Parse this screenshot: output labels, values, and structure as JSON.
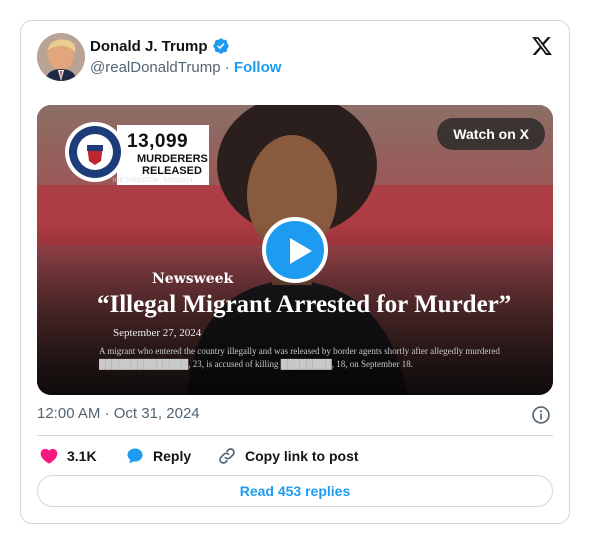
{
  "author": {
    "name": "Donald J. Trump",
    "handle": "@realDonaldTrump",
    "separator": "·",
    "follow_label": "Follow"
  },
  "media": {
    "watch_label": "Watch on X",
    "badge": {
      "seal_text": "U.S. DEPARTMENT OF HOMELAND SECURITY",
      "count": "13,099",
      "line1": "MURDERERS",
      "line2": "RELEASED",
      "source": "ICE DIRECTOR, 9/25/2024"
    },
    "newsweek": {
      "brand": "Newsweek",
      "headline": "“Illegal Migrant Arrested for Murder”",
      "date": "September 27, 2024",
      "body": "A migrant who entered the country illegally and was released by border agents shortly after allegedly murdered ██████████████, 23, is accused of killing ████████, 18, on September 18."
    }
  },
  "timestamp": {
    "time": "12:00 AM",
    "separator": "·",
    "date": "Oct 31, 2024"
  },
  "actions": {
    "likes": "3.1K",
    "reply_label": "Reply",
    "copy_label": "Copy link to post"
  },
  "read_replies_label": "Read 453 replies",
  "colors": {
    "accent": "#1d9bf0",
    "like": "#f91880",
    "text_secondary": "#536471",
    "border": "#cfd9de"
  }
}
